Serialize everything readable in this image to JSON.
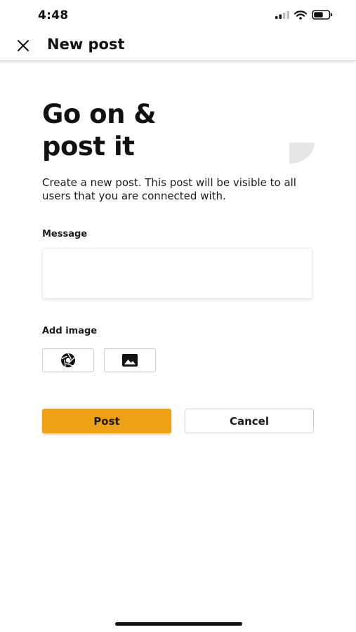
{
  "status_bar": {
    "time": "4:48",
    "icons": [
      "signal-icon",
      "wifi-icon",
      "battery-icon"
    ]
  },
  "nav": {
    "close_icon": "close-icon",
    "title": "New post"
  },
  "content": {
    "headline_line1": "Go on &",
    "headline_line2": "post it",
    "description": "Create a new post. This post will be visible to all users that you are connected with.",
    "message_label": "Message",
    "message_value": "",
    "message_placeholder": "",
    "add_image_label": "Add image",
    "image_buttons": [
      "camera-icon",
      "gallery-icon"
    ]
  },
  "actions": {
    "post_label": "Post",
    "cancel_label": "Cancel"
  },
  "colors": {
    "accent": "#efa116",
    "text": "#111111",
    "decor": "#e6e6e6"
  }
}
